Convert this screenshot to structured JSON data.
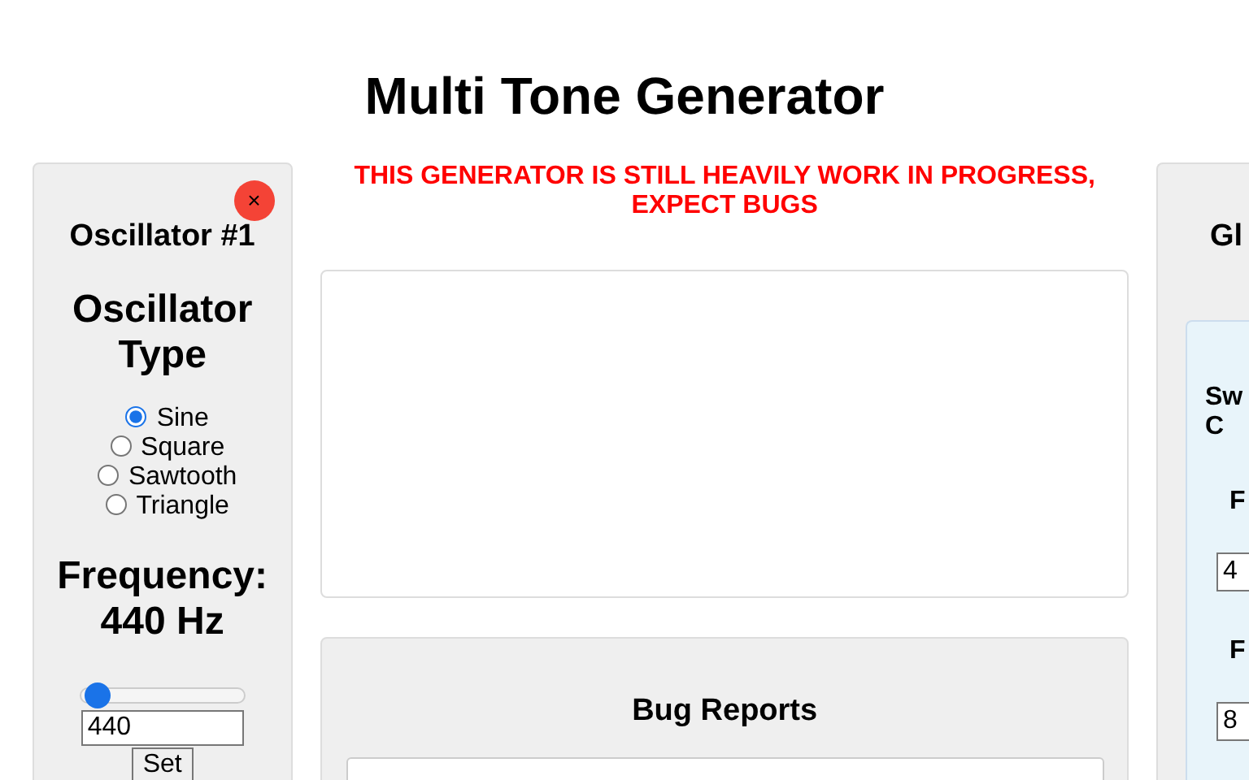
{
  "title": "Multi Tone Generator",
  "warning": "THIS GENERATOR IS STILL HEAVILY WORK IN PROGRESS, EXPECT BUGS",
  "oscillator": {
    "title": "Oscillator #1",
    "close": "×",
    "type_heading": "Oscillator Type",
    "types": [
      {
        "label": "Sine",
        "selected": true
      },
      {
        "label": "Square",
        "selected": false
      },
      {
        "label": "Sawtooth",
        "selected": false
      },
      {
        "label": "Triangle",
        "selected": false
      }
    ],
    "frequency_heading": "Frequency: 440 Hz",
    "slider": {
      "level": 0.02
    },
    "frequency_value": "440",
    "set_button": "Set"
  },
  "bug_reports": {
    "title": "Bug Reports"
  },
  "global_panel": {
    "title": "Gl",
    "inner_lines": [
      "Sw",
      "C"
    ],
    "fields": [
      {
        "label": "F",
        "value": "4"
      },
      {
        "label": "F",
        "value": "8"
      }
    ]
  }
}
